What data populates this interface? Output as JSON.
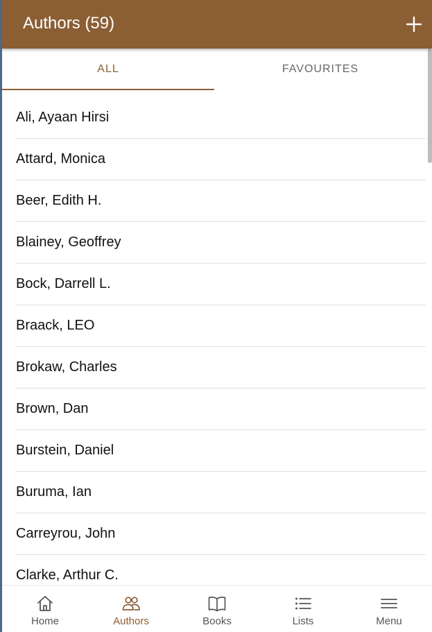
{
  "header": {
    "title": "Authors (59)",
    "add_icon": "plus-icon"
  },
  "tabs": [
    {
      "label": "ALL",
      "active": true
    },
    {
      "label": "FAVOURITES",
      "active": false
    }
  ],
  "authors": [
    "Ali, Ayaan Hirsi",
    "Attard, Monica",
    "Beer, Edith H.",
    "Blainey, Geoffrey",
    "Bock, Darrell L.",
    "Braack, LEO",
    "Brokaw, Charles",
    "Brown, Dan",
    "Burstein, Daniel",
    "Buruma, Ian",
    "Carreyrou, John",
    "Clarke, Arthur C."
  ],
  "bottom_nav": [
    {
      "label": "Home",
      "icon": "home-icon",
      "active": false
    },
    {
      "label": "Authors",
      "icon": "people-icon",
      "active": true
    },
    {
      "label": "Books",
      "icon": "book-icon",
      "active": false
    },
    {
      "label": "Lists",
      "icon": "list-icon",
      "active": false
    },
    {
      "label": "Menu",
      "icon": "menu-icon",
      "active": false
    }
  ],
  "colors": {
    "accent": "#8b5e34",
    "background": "#ffffff",
    "text": "#111111"
  }
}
